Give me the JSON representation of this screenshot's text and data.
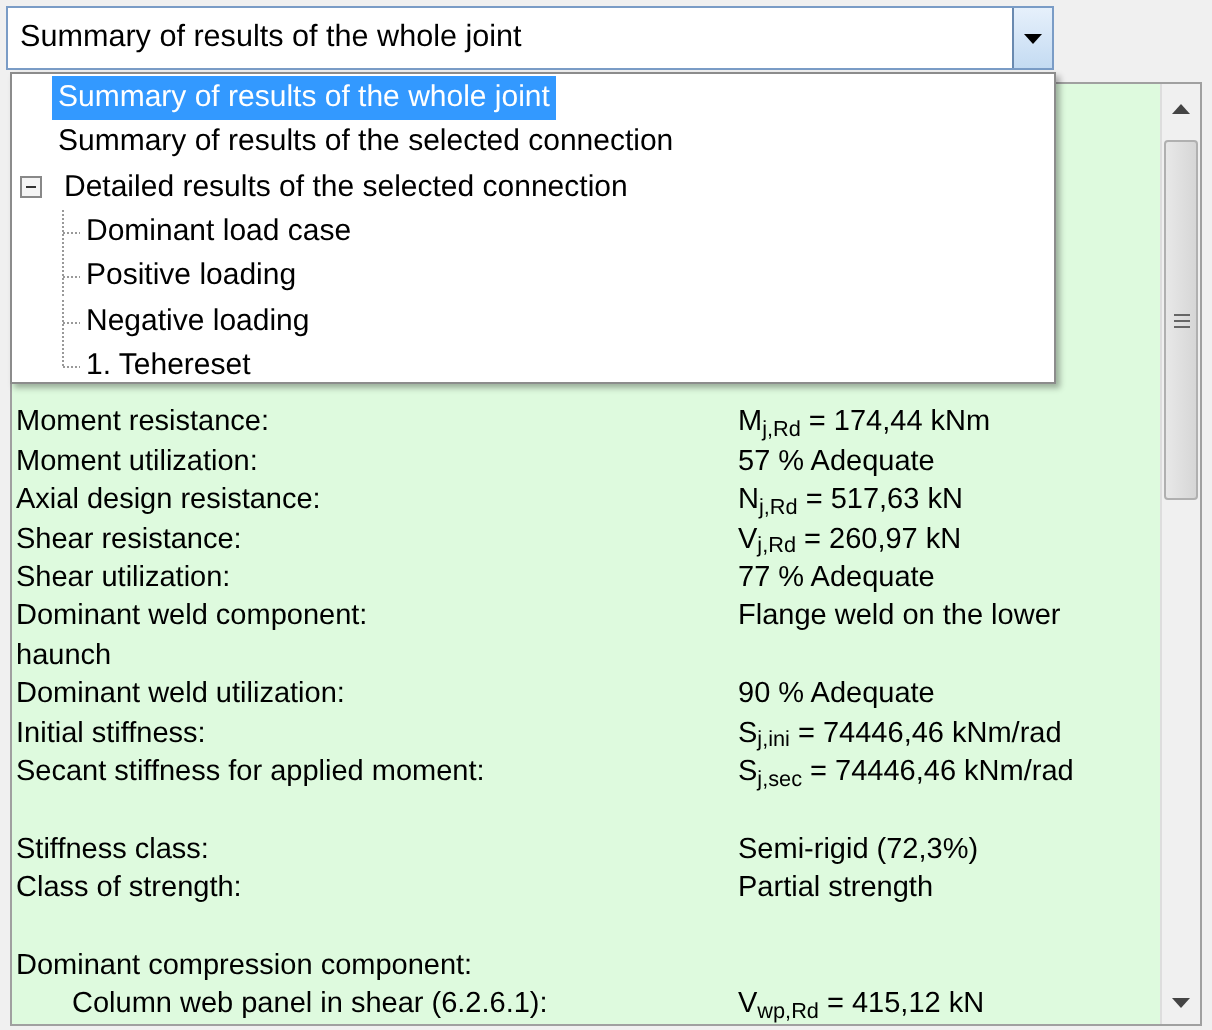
{
  "combo": {
    "value": "Summary of results of the whole joint"
  },
  "dropdown": {
    "items": [
      {
        "label": "Summary of results of the whole joint",
        "selected": true
      },
      {
        "label": "Summary of results of the selected connection",
        "selected": false
      },
      {
        "label": "Detailed results of the selected connection",
        "selected": false,
        "expanded": true,
        "children": [
          {
            "label": "Dominant load case",
            "selected": false
          },
          {
            "label": "Positive loading",
            "selected": false
          },
          {
            "label": "Negative loading",
            "selected": false
          },
          {
            "label": "1. Tehereset",
            "selected": false
          }
        ]
      }
    ]
  },
  "results": [
    {
      "kind": "gap"
    },
    {
      "kind": "row",
      "label": "Moment resistance:",
      "value": "M$_{j,Rd}$ = 174,44 kNm"
    },
    {
      "kind": "row",
      "label": "Moment utilization:",
      "value": "57 % Adequate"
    },
    {
      "kind": "row",
      "label": "Axial design resistance:",
      "value": "N$_{j,Rd}$ = 517,63 kN"
    },
    {
      "kind": "row",
      "label": "Shear resistance:",
      "value": "V$_{j,Rd}$ = 260,97 kN"
    },
    {
      "kind": "row",
      "label": "Shear utilization:",
      "value": "77 % Adequate"
    },
    {
      "kind": "row",
      "label": "Dominant weld component:",
      "value": "Flange weld on the lower",
      "continuation": "haunch"
    },
    {
      "kind": "row",
      "label": "Dominant weld utilization:",
      "value": "90 % Adequate"
    },
    {
      "kind": "row",
      "label": "Initial stiffness:",
      "value": "S$_{j,ini}$ = 74446,46 kNm/rad"
    },
    {
      "kind": "row",
      "label": "Secant stiffness for applied moment:",
      "value": "S$_{j,sec}$ = 74446,46 kNm/rad"
    },
    {
      "kind": "gap"
    },
    {
      "kind": "row",
      "label": "Stiffness class:",
      "value": "Semi-rigid (72,3%)"
    },
    {
      "kind": "row",
      "label": "Class of strength:",
      "value": "Partial strength"
    },
    {
      "kind": "gap"
    },
    {
      "kind": "row",
      "label": "Dominant compression component:"
    },
    {
      "kind": "sub",
      "label": "Column web panel in shear (6.2.6.1):",
      "value": "V$_{wp,Rd}$ = 415,12 kN"
    }
  ]
}
